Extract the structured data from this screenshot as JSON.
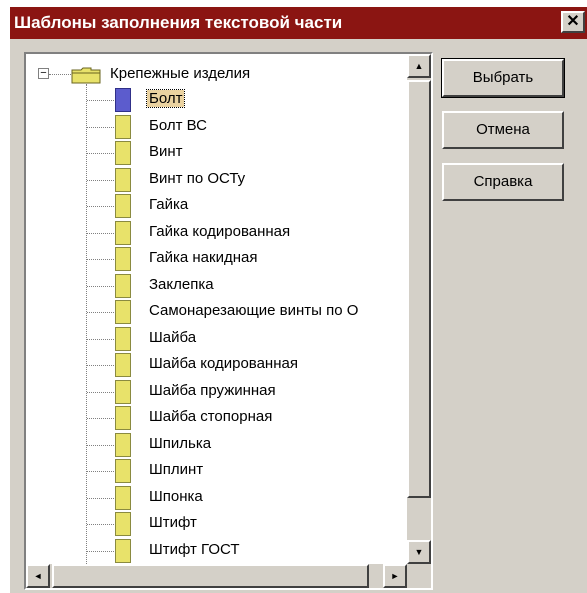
{
  "dialog": {
    "title": "Шаблоны заполнения текстовой части",
    "close_glyph": "✕"
  },
  "tree": {
    "root": {
      "label": "Крепежные изделия",
      "expander": "−"
    },
    "selected_index": 0,
    "items": [
      "Болт",
      "Болт ВС",
      "Винт",
      "Винт по ОСТу",
      "Гайка",
      "Гайка кодированная",
      "Гайка накидная",
      "Заклепка",
      "Самонарезающие винты по О",
      "Шайба",
      "Шайба кодированная",
      "Шайба пружинная",
      "Шайба стопорная",
      "Шпилька",
      "Шплинт",
      "Шпонка",
      "Штифт",
      "Штифт ГОСТ"
    ]
  },
  "buttons": {
    "select": "Выбрать",
    "cancel": "Отмена",
    "help": "Справка"
  },
  "scroll": {
    "up": "▲",
    "down": "▼",
    "left": "◄",
    "right": "►"
  },
  "colors": {
    "title_bar": "#8b1512",
    "dialog_face": "#d4d0c8",
    "doc_icon": "#e8e26a",
    "selected_icon": "#5c5ccd",
    "selected_highlight": "#ead2a0"
  }
}
